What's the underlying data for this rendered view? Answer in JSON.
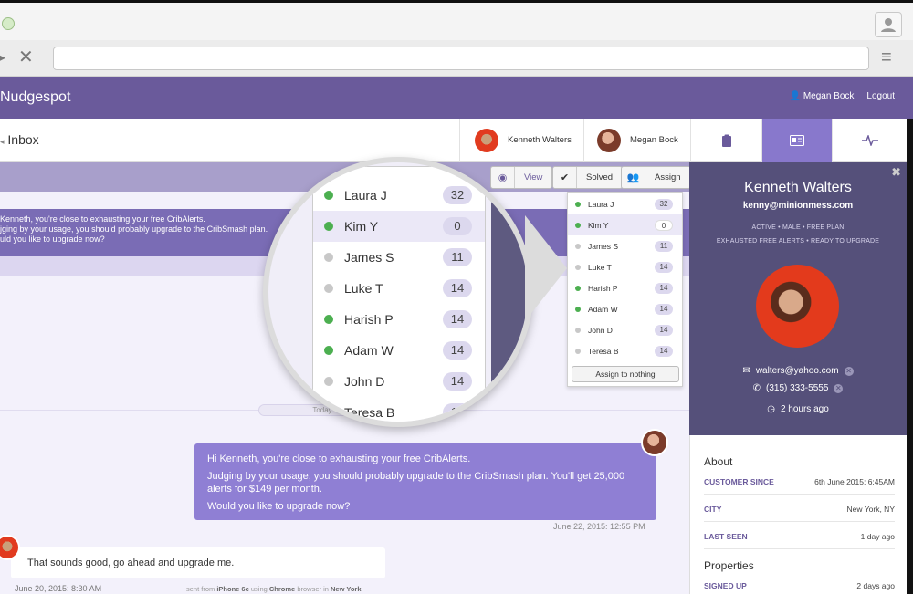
{
  "app": {
    "brand": "Nudgespot",
    "user_name": "Megan Bock",
    "logout": "Logout"
  },
  "page": {
    "title": "Inbox"
  },
  "tabs": [
    {
      "label": "Kenneth Walters"
    },
    {
      "label": "Megan Bock"
    }
  ],
  "toolbar": {
    "view": "View",
    "solved": "Solved",
    "assign": "Assign"
  },
  "alert": {
    "line1": "Kenneth, you're close to exhausting your free CribAlerts.",
    "line2": "jging by your usage, you should probably upgrade to the CribSmash plan.",
    "line3": "uld you like to upgrade now?"
  },
  "today": "Today",
  "message": {
    "p1": "Hi Kenneth, you're close to exhausting your free CribAlerts.",
    "p2": "Judging by your usage, you should probably upgrade to the CribSmash plan. You'll get 25,000 alerts for $149 per month.",
    "p3": "Would you like to upgrade now?",
    "time": "June 22, 2015: 12:55 PM"
  },
  "reply": {
    "text": "That sounds good, go ahead and upgrade me.",
    "time": "June 20, 2015: 8:30 AM",
    "src_pre": "sent from ",
    "device": "iPhone 6c",
    "src_mid": " using ",
    "browser": "Chrome",
    "src_mid2": " browser in ",
    "city": "New York"
  },
  "assignees": [
    {
      "name": "Laura J",
      "count": "32",
      "online": true
    },
    {
      "name": "Kim Y",
      "count": "0",
      "online": true,
      "selected": true
    },
    {
      "name": "James S",
      "count": "11",
      "online": false
    },
    {
      "name": "Luke T",
      "count": "14",
      "online": false
    },
    {
      "name": "Harish P",
      "count": "14",
      "online": true
    },
    {
      "name": "Adam W",
      "count": "14",
      "online": true
    },
    {
      "name": "John D",
      "count": "14",
      "online": false
    },
    {
      "name": "Teresa B",
      "count": "14",
      "online": false
    }
  ],
  "assign_nothing": "Assign to nothing",
  "customer": {
    "name": "Kenneth Walters",
    "email": "kenny@minionmess.com",
    "tags1": "ACTIVE  •  MALE  •  FREE PLAN",
    "tags2": "EXHAUSTED FREE ALERTS  •  READY TO UPGRADE",
    "contact_email": "walters@yahoo.com",
    "phone": "(315) 333-5555",
    "last_active": "2 hours ago"
  },
  "about": {
    "title": "About",
    "rows": [
      {
        "k": "CUSTOMER SINCE",
        "v": "6th June 2015; 6:45AM"
      },
      {
        "k": "CITY",
        "v": "New York, NY"
      },
      {
        "k": "LAST SEEN",
        "v": "1 day ago"
      }
    ],
    "properties_title": "Properties",
    "prop_rows": [
      {
        "k": "SIGNED UP",
        "v": "2 days ago"
      }
    ]
  },
  "colors": {
    "header": "#6a5a9b",
    "accent": "#8f7fd4",
    "online": "#4caf50",
    "offline": "#c8c8c8"
  }
}
